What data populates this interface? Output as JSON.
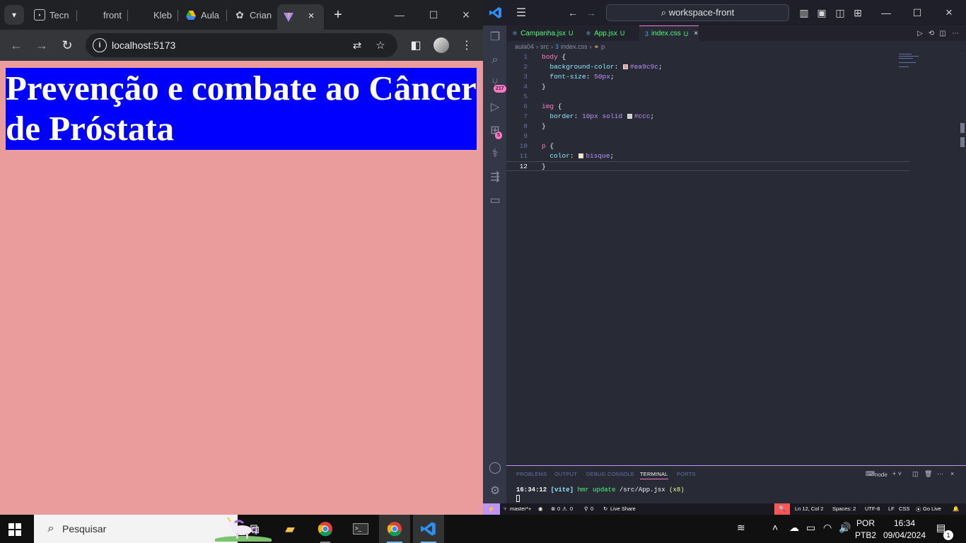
{
  "chrome": {
    "tabs": [
      {
        "label": "Tecn",
        "favicon": "profile-icon"
      },
      {
        "label": "front",
        "favicon": "github-icon"
      },
      {
        "label": "Kleb",
        "favicon": "github-icon"
      },
      {
        "label": "Aula",
        "favicon": "google-drive-icon"
      },
      {
        "label": "Crian",
        "favicon": "chatgpt-icon"
      },
      {
        "label": "",
        "favicon": "vite-icon",
        "active": true
      }
    ],
    "url": "localhost:5173"
  },
  "page": {
    "heading": "Prevenção e combate ao Câncer de Próstata",
    "background": "#ea9c9c",
    "heading_background": "#0000ff"
  },
  "vscode": {
    "command_center": "workspace-front",
    "tabs": [
      {
        "label": "Campanha.jsx",
        "status": "U",
        "icon": "react-icon"
      },
      {
        "label": "App.jsx",
        "status": "U",
        "icon": "react-icon"
      },
      {
        "label": "index.css",
        "status": "U",
        "icon": "css-icon",
        "active": true
      }
    ],
    "breadcrumb": [
      "aula04",
      "src",
      "index.css",
      "p"
    ],
    "code_lines": [
      {
        "n": "1",
        "tokens": [
          {
            "t": "body",
            "c": "sel"
          },
          {
            "t": " {",
            "c": "plain"
          }
        ]
      },
      {
        "n": "2",
        "tokens": [
          {
            "t": "  background-color",
            "c": "prop"
          },
          {
            "t": ": ",
            "c": "plain"
          },
          {
            "t": "#ea9c9c",
            "c": "val",
            "swatch": "#ea9c9c"
          },
          {
            "t": ";",
            "c": "plain"
          }
        ]
      },
      {
        "n": "3",
        "tokens": [
          {
            "t": "  font-size",
            "c": "prop"
          },
          {
            "t": ": ",
            "c": "plain"
          },
          {
            "t": "50px",
            "c": "val"
          },
          {
            "t": ";",
            "c": "plain"
          }
        ]
      },
      {
        "n": "4",
        "tokens": [
          {
            "t": "}",
            "c": "plain"
          }
        ]
      },
      {
        "n": "5",
        "tokens": []
      },
      {
        "n": "6",
        "tokens": [
          {
            "t": "img",
            "c": "sel"
          },
          {
            "t": " {",
            "c": "plain"
          }
        ]
      },
      {
        "n": "7",
        "tokens": [
          {
            "t": "  border",
            "c": "prop"
          },
          {
            "t": ": ",
            "c": "plain"
          },
          {
            "t": "10px solid ",
            "c": "val"
          },
          {
            "t": "#ccc",
            "c": "val",
            "swatch": "#cccccc"
          },
          {
            "t": ";",
            "c": "plain"
          }
        ]
      },
      {
        "n": "8",
        "tokens": [
          {
            "t": "}",
            "c": "plain"
          }
        ]
      },
      {
        "n": "9",
        "tokens": []
      },
      {
        "n": "10",
        "tokens": [
          {
            "t": "p",
            "c": "sel"
          },
          {
            "t": " {",
            "c": "plain"
          }
        ]
      },
      {
        "n": "11",
        "tokens": [
          {
            "t": "  color",
            "c": "prop"
          },
          {
            "t": ": ",
            "c": "plain"
          },
          {
            "t": "bisque",
            "c": "val",
            "swatch": "#ffe4c4"
          },
          {
            "t": ";",
            "c": "plain"
          }
        ]
      },
      {
        "n": "12",
        "tokens": [
          {
            "t": "}",
            "c": "plain"
          }
        ],
        "current": true
      }
    ],
    "panel": {
      "tabs": [
        "PROBLEMS",
        "OUTPUT",
        "DEBUG CONSOLE",
        "TERMINAL",
        "PORTS"
      ],
      "active_tab": "TERMINAL",
      "terminal_name": "node",
      "terminal": {
        "time": "16:34:12",
        "tag": "[vite]",
        "msg": "hmr update",
        "path": "/src/App.jsx",
        "count": "(x8)"
      }
    },
    "statusbar": {
      "branch": "master*+",
      "errors": "0",
      "warnings": "0",
      "ports": "0",
      "live_share": "Live Share",
      "position": "Ln 12, Col 2",
      "spaces": "Spaces: 2",
      "encoding": "UTF-8",
      "eol": "LF",
      "language": "CSS",
      "go_live": "Go Live"
    },
    "activity_badges": {
      "source_control": "217",
      "extensions": "5"
    }
  },
  "taskbar": {
    "search_placeholder": "Pesquisar",
    "lang_top": "POR",
    "lang_bottom": "PTB2",
    "time": "16:34",
    "date": "09/04/2024",
    "notifications": "1"
  }
}
